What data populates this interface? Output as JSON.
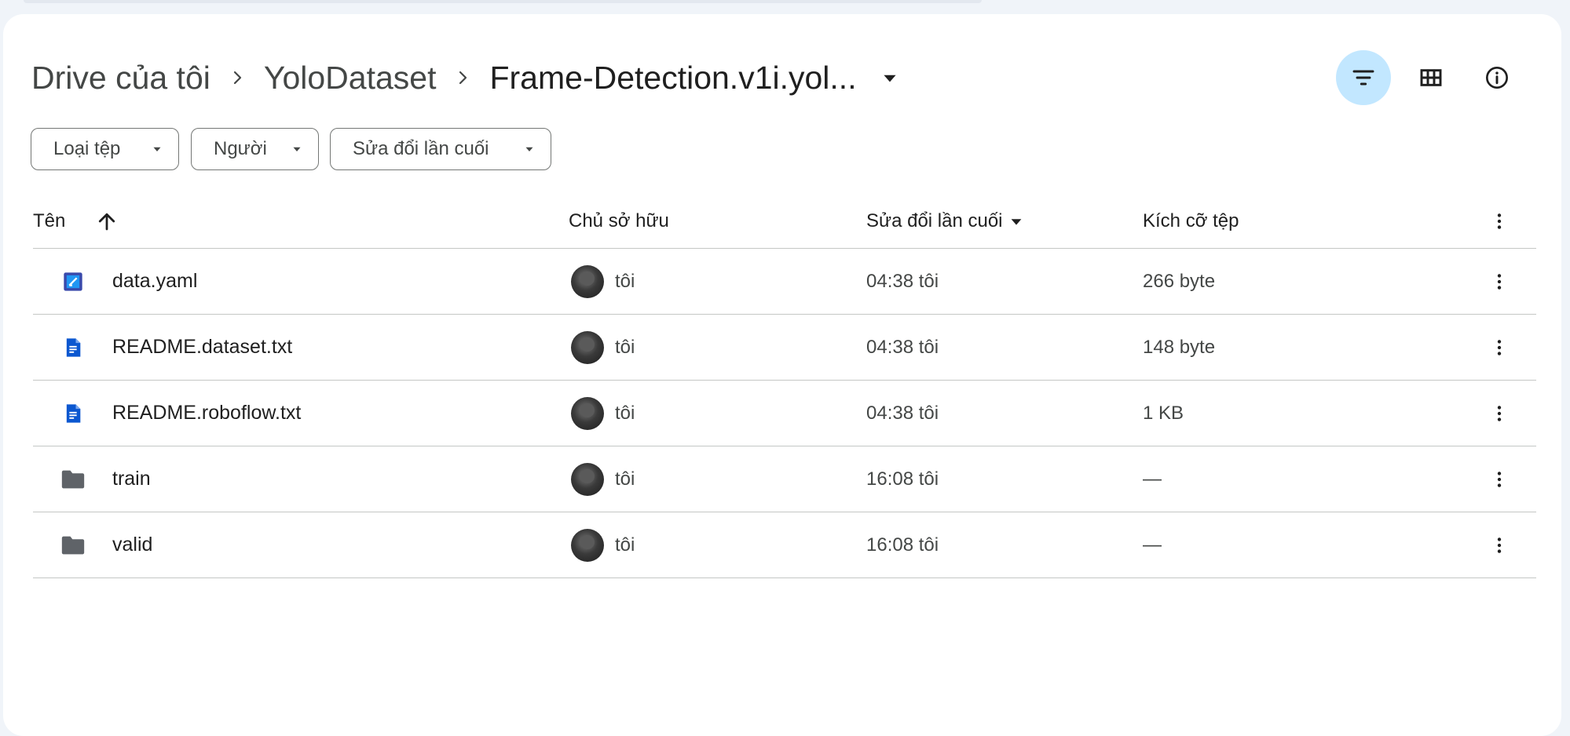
{
  "breadcrumb": {
    "items": [
      "Drive của tôi",
      "YoloDataset"
    ],
    "current": "Frame-Detection.v1i.yol..."
  },
  "header_actions": {
    "filter_icon": "filter-list-icon",
    "grid_icon": "grid-view-icon",
    "info_icon": "info-icon"
  },
  "filters": [
    {
      "label": "Loại tệp"
    },
    {
      "label": "Người"
    },
    {
      "label": "Sửa đổi lần cuối"
    }
  ],
  "table": {
    "headers": {
      "name": "Tên",
      "owner": "Chủ sở hữu",
      "modified": "Sửa đổi lần cuối",
      "size": "Kích cỡ tệp"
    },
    "rows": [
      {
        "icon": "yaml-file-icon",
        "name": "data.yaml",
        "owner": "tôi",
        "modified_time": "04:38",
        "modified_by": "tôi",
        "size": "266 byte"
      },
      {
        "icon": "doc-file-icon",
        "name": "README.dataset.txt",
        "owner": "tôi",
        "modified_time": "04:38",
        "modified_by": "tôi",
        "size": "148 byte"
      },
      {
        "icon": "doc-file-icon",
        "name": "README.roboflow.txt",
        "owner": "tôi",
        "modified_time": "04:38",
        "modified_by": "tôi",
        "size": "1 KB"
      },
      {
        "icon": "folder-icon",
        "name": "train",
        "owner": "tôi",
        "modified_time": "16:08",
        "modified_by": "tôi",
        "size": "—"
      },
      {
        "icon": "folder-icon",
        "name": "valid",
        "owner": "tôi",
        "modified_time": "16:08",
        "modified_by": "tôi",
        "size": "—"
      }
    ]
  },
  "colors": {
    "accent_active_bg": "#c2e7ff",
    "doc_blue": "#0b57d0",
    "folder_gray": "#5f6368",
    "border": "#c4c7c5"
  }
}
